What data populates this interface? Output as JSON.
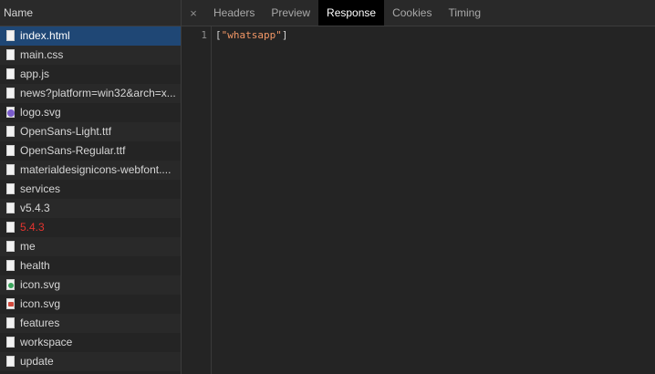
{
  "name_column": {
    "header": "Name"
  },
  "requests": [
    {
      "label": "index.html",
      "icon": "document-icon",
      "state": "selected"
    },
    {
      "label": "main.css",
      "icon": "document-icon"
    },
    {
      "label": "app.js",
      "icon": "document-icon"
    },
    {
      "label": "news?platform=win32&arch=x...",
      "icon": "document-icon"
    },
    {
      "label": "logo.svg",
      "icon": "svg-image-icon",
      "badge": "purple"
    },
    {
      "label": "OpenSans-Light.ttf",
      "icon": "document-icon"
    },
    {
      "label": "OpenSans-Regular.ttf",
      "icon": "document-icon"
    },
    {
      "label": "materialdesignicons-webfont....",
      "icon": "document-icon"
    },
    {
      "label": "services",
      "icon": "document-icon"
    },
    {
      "label": "v5.4.3",
      "icon": "document-icon"
    },
    {
      "label": "5.4.3",
      "icon": "error-document-icon",
      "state": "error"
    },
    {
      "label": "me",
      "icon": "document-icon"
    },
    {
      "label": "health",
      "icon": "document-icon"
    },
    {
      "label": "icon.svg",
      "icon": "whatsapp-image-icon",
      "badge": "green"
    },
    {
      "label": "icon.svg",
      "icon": "gmail-image-icon",
      "badge": "red"
    },
    {
      "label": "features",
      "icon": "document-icon"
    },
    {
      "label": "workspace",
      "icon": "document-icon"
    },
    {
      "label": "update",
      "icon": "document-icon"
    }
  ],
  "detail": {
    "close_glyph": "×",
    "tabs": [
      {
        "label": "Headers"
      },
      {
        "label": "Preview"
      },
      {
        "label": "Response",
        "active": true
      },
      {
        "label": "Cookies"
      },
      {
        "label": "Timing"
      }
    ],
    "response": {
      "line_number": "1",
      "open": "[",
      "string": "\"whatsapp\"",
      "close": "]"
    }
  },
  "colors": {
    "selected_row": "#1f4775",
    "error_text": "#e3342f",
    "string_token": "#f29766",
    "active_tab": "#000000"
  }
}
